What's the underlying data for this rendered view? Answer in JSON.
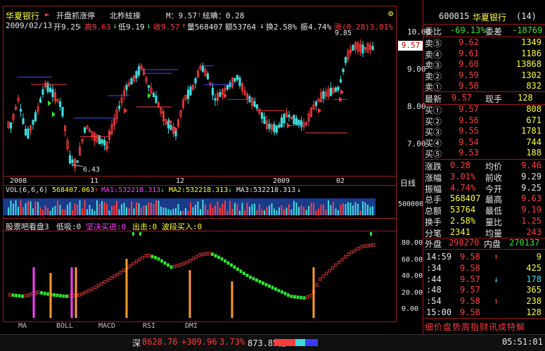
{
  "header": {
    "stock_name": "华夏银行",
    "flag_label": "开盘抓涨停",
    "lock_label": "北柞絃掾",
    "m_value": "M：9.57",
    "extra": "絃晪：0.28"
  },
  "info_line": {
    "date": "2009/02/13",
    "open": "开9.25",
    "high": "高9.63",
    "low": "低9.19",
    "close": "收9.57",
    "volume": "量568407",
    "amount": "额53764",
    "turnover": "换2.58%",
    "amplitude": "振4.74%",
    "change": "涨(0.28)3.01%"
  },
  "price_chart": {
    "y_ticks": [
      "10.00",
      "9.00",
      "8.00",
      "7.00"
    ],
    "y_tick_values": [
      10,
      9,
      8,
      7
    ],
    "marker_high": "9.85",
    "marker_low": "6.43",
    "current_price_tag": "9.57",
    "x_labels": [
      "2008",
      "11",
      "12",
      "2009",
      "02"
    ],
    "period": "日线"
  },
  "volume_panel": {
    "title": "VOL(6,6,6)",
    "value": "568407.063",
    "ma1": "MA1:532218.313",
    "ma2": "MA2:532218.313",
    "ma3": "MA3:532218.313",
    "y_tick": "500000"
  },
  "indicator_panel": {
    "name": "股票吧看盘3",
    "low_absorb": "低吸:0",
    "decisive_buy": "坚决买进:0",
    "strike": "出击:0",
    "band_buy": "波段买入:0",
    "y_ticks": [
      "80.00",
      "60.00",
      "40.00",
      "20.00",
      "0.00"
    ]
  },
  "bottom_tabs": [
    "MA",
    "BOLL",
    "MACD",
    "RSI",
    "DMI"
  ],
  "quote": {
    "code": "600015",
    "name": "华夏银行",
    "count": "(14)",
    "ratio_label": "委比",
    "ratio_value": "-69.13%",
    "diff_label": "委差",
    "diff_value": "-18769",
    "asks": [
      {
        "label": "卖⑤",
        "price": "9.62",
        "vol": "1349"
      },
      {
        "label": "卖④",
        "price": "9.61",
        "vol": "1186"
      },
      {
        "label": "卖③",
        "price": "9.60",
        "vol": "13868"
      },
      {
        "label": "卖②",
        "price": "9.59",
        "vol": "1302"
      },
      {
        "label": "卖①",
        "price": "9.58",
        "vol": "832"
      }
    ],
    "latest_label": "最新",
    "latest_value": "9.57",
    "hand_label": "现手",
    "hand_value": "128",
    "bids": [
      {
        "label": "买①",
        "price": "9.57",
        "vol": "808"
      },
      {
        "label": "买②",
        "price": "9.56",
        "vol": "671"
      },
      {
        "label": "买③",
        "price": "9.55",
        "vol": "1781"
      },
      {
        "label": "买④",
        "price": "9.54",
        "vol": "744"
      },
      {
        "label": "买⑤",
        "price": "9.53",
        "vol": "188"
      }
    ],
    "stats": [
      {
        "l1": "涨跌",
        "v1": "0.28",
        "l2": "均价",
        "v2": "9.46"
      },
      {
        "l1": "涨幅",
        "v1": "3.01%",
        "l2": "前收",
        "v2": "9.29"
      },
      {
        "l1": "振幅",
        "v1": "4.74%",
        "l2": "今开",
        "v2": "9.25"
      },
      {
        "l1": "总手",
        "v1": "568407",
        "l2": "最高",
        "v2": "9.63"
      },
      {
        "l1": "总额",
        "v1": "53764",
        "l2": "最低",
        "v2": "9.19"
      },
      {
        "l1": "换手",
        "v1": "2.58%",
        "l2": "量比",
        "v2": "1.25"
      },
      {
        "l1": "分笔",
        "v1": "2341",
        "l2": "均量",
        "v2": "243"
      }
    ],
    "outer_label": "外盘",
    "outer_value": "298270",
    "inner_label": "内盘",
    "inner_value": "270137",
    "ticks": [
      {
        "time": "14:59",
        "price": "9.58",
        "vol": "9",
        "dir": "up"
      },
      {
        "time": ":34",
        "price": "9.58",
        "vol": "425",
        "dir": ""
      },
      {
        "time": ":44",
        "price": "9.57",
        "vol": "178",
        "dir": "down"
      },
      {
        "time": ":48",
        "price": "9.57",
        "vol": "365",
        "dir": ""
      },
      {
        "time": ":54",
        "price": "9.58",
        "vol": "238",
        "dir": "up"
      },
      {
        "time": "15:00",
        "price": "9.58",
        "vol": "128",
        "dir": ""
      }
    ],
    "bottom_tabs": "细价盘势周指财讯成特解"
  },
  "status": {
    "index_name": "深",
    "index_value": "8628.76",
    "index_change": "+309.96",
    "index_pct": "3.73%",
    "index_amount": "873.85亿",
    "clock": "05:51:01"
  },
  "colors": {
    "up": "#ff3c3c",
    "down": "#2ee82e",
    "frame": "#a01818",
    "ma_blue": "#3c50ff",
    "label_yellow": "#ffff3c"
  }
}
